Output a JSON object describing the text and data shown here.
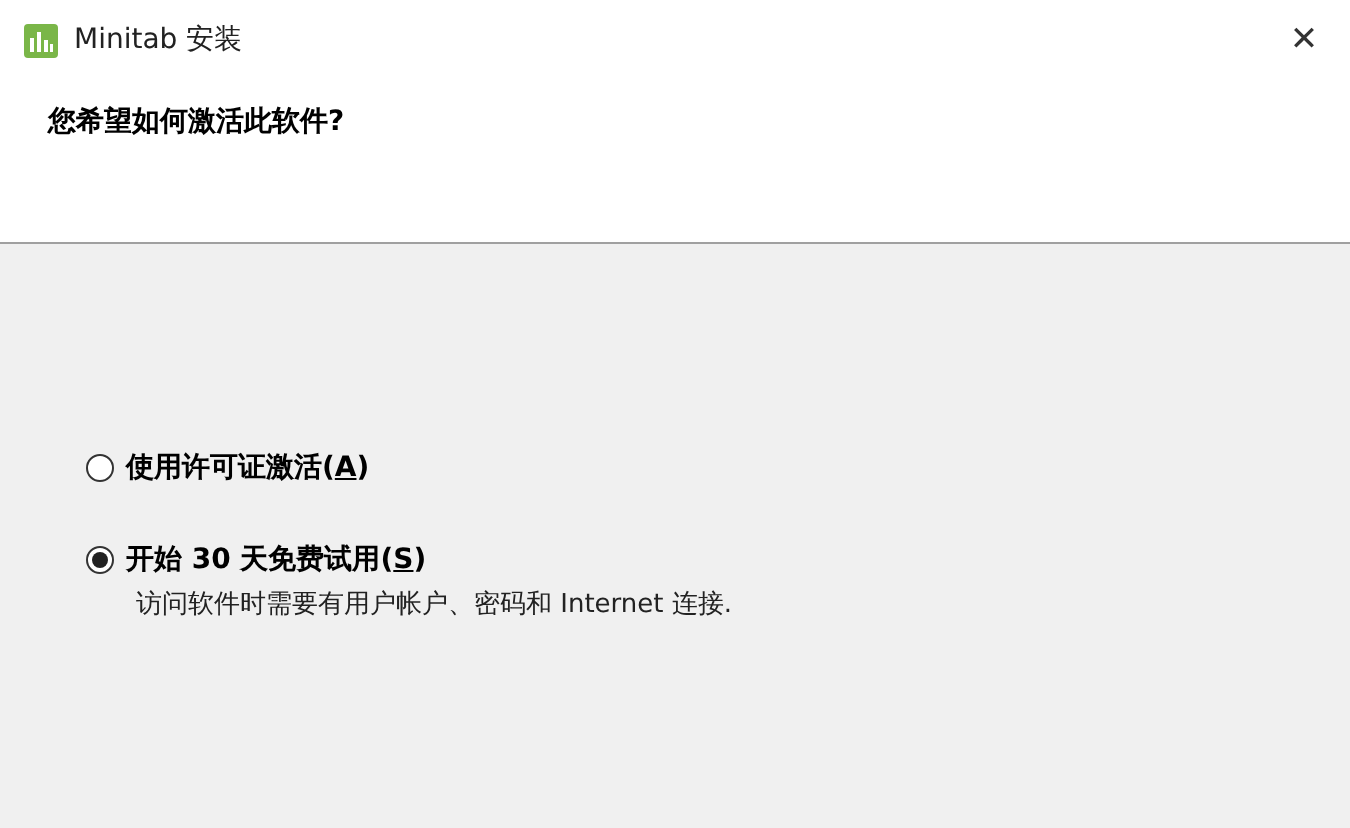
{
  "window": {
    "title": "Minitab 安装",
    "close": "✕"
  },
  "header": {
    "question": "您希望如何激活此软件?"
  },
  "options": [
    {
      "before": "使用许可证激活(",
      "access_key": "A",
      "after": ")",
      "selected": false
    },
    {
      "before": "开始 30 天免费试用(",
      "access_key": "S",
      "after": ")",
      "selected": true,
      "description": "访问软件时需要有用户帐户、密码和 Internet 连接."
    }
  ]
}
